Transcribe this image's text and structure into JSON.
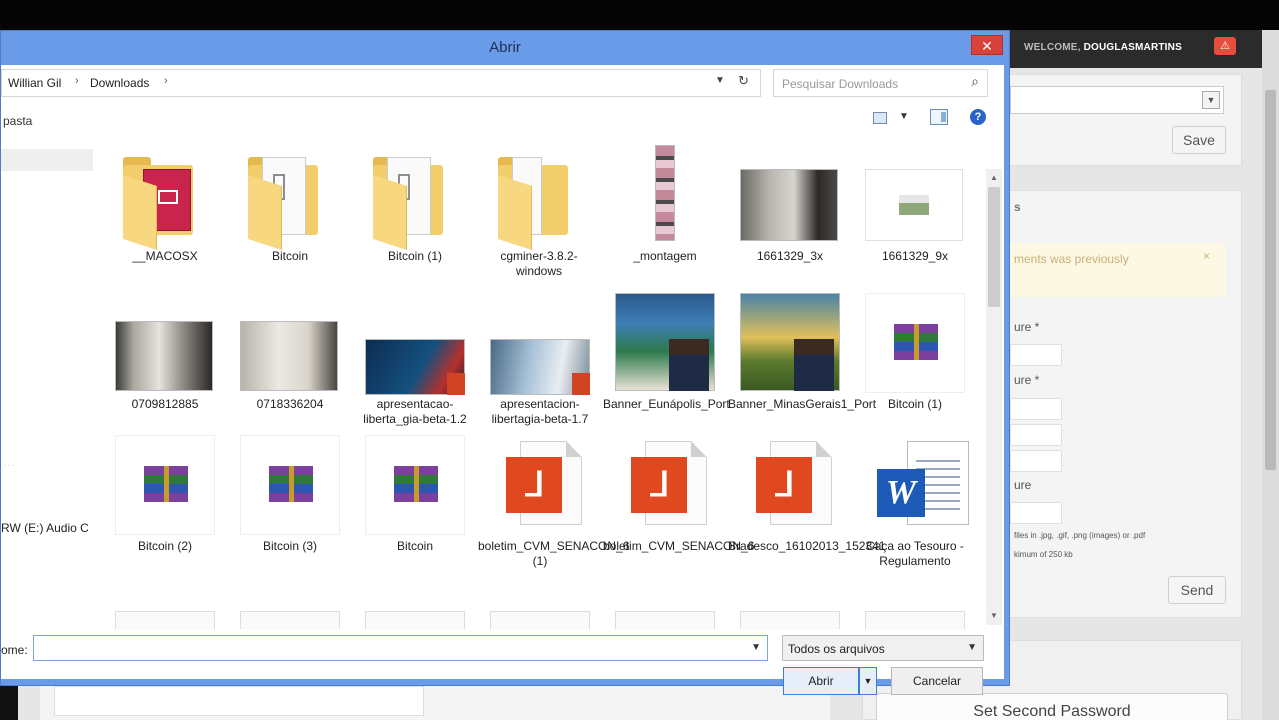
{
  "site": {
    "welcome_prefix": "WELCOME,",
    "username": "DOUGLASMARTINS",
    "save_label": "Save",
    "notice_text": "ments was previously",
    "notice_close": "×",
    "section_title": "s",
    "field_labels": [
      "ure *",
      "ure *",
      "ure"
    ],
    "help_line1": "files in .jpg, .gif, .png (images) or .pdf",
    "help_line2": "kimum of 250 kb",
    "send_label": "Send",
    "second_password_label": "Set Second Password"
  },
  "dialog": {
    "title": "Abrir",
    "close_glyph": "✕",
    "breadcrumb": [
      "Willian Gil",
      "Downloads"
    ],
    "search_placeholder": "Pesquisar Downloads",
    "new_folder_label": "pasta",
    "nav_drive_label": "RW (E:) Audio C",
    "filename_label": "ome:",
    "filename_value": "",
    "filetype_selected": "Todos os arquivos",
    "open_label": "Abrir",
    "cancel_label": "Cancelar"
  },
  "files": [
    {
      "name": "__MACOSX",
      "kind": "folder-media"
    },
    {
      "name": "Bitcoin",
      "kind": "folder"
    },
    {
      "name": "Bitcoin (1)",
      "kind": "folder"
    },
    {
      "name": "cgminer-3.8.2-windows",
      "kind": "folder"
    },
    {
      "name": "_montagem",
      "kind": "image-strip"
    },
    {
      "name": "1661329_3x",
      "kind": "photo-bathroom"
    },
    {
      "name": "1661329_9x",
      "kind": "photo-small"
    },
    {
      "name": "0709812885",
      "kind": "photo-room"
    },
    {
      "name": "0718336204",
      "kind": "photo-room-light"
    },
    {
      "name": "apresentacao-liberta_gia-beta-1.2",
      "kind": "pptx-blue"
    },
    {
      "name": "apresentacion-libertagia-beta-1.7",
      "kind": "pptx-sky"
    },
    {
      "name": "Banner_Eunápolis_Port",
      "kind": "banner"
    },
    {
      "name": "Banner_MinasGerais1_Port",
      "kind": "banner"
    },
    {
      "name": "Bitcoin (1)",
      "kind": "archive"
    },
    {
      "name": "Bitcoin (2)",
      "kind": "archive"
    },
    {
      "name": "Bitcoin (3)",
      "kind": "archive"
    },
    {
      "name": "Bitcoin",
      "kind": "archive"
    },
    {
      "name": "boletim_CVM_SENACON_6 (1)",
      "kind": "pdf"
    },
    {
      "name": "boletim_CVM_SENACON_6",
      "kind": "pdf"
    },
    {
      "name": "Bradesco_16102013_152341",
      "kind": "pdf"
    },
    {
      "name": "Caça ao Tesouro - Regulamento",
      "kind": "word"
    }
  ],
  "colors": {
    "dialog_frame": "#6a9be8",
    "close_red": "#d9423a",
    "folder_yellow": "#f2cd6b",
    "pdf_orange": "#e0481f",
    "word_blue": "#1e5bb8"
  }
}
